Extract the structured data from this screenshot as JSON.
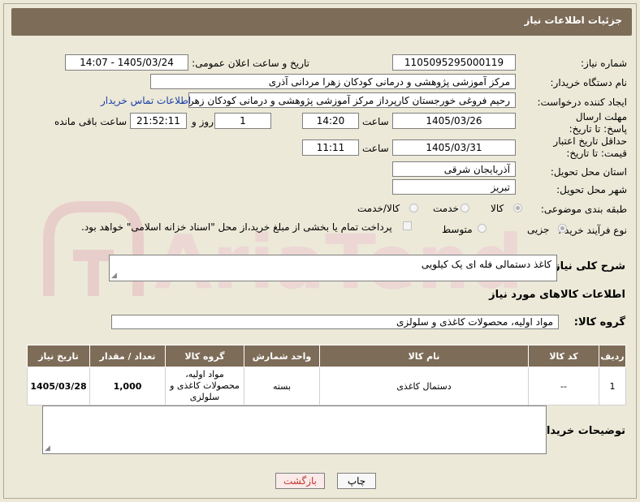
{
  "header": {
    "title": "جزئیات اطلاعات نیاز"
  },
  "need_number": {
    "label": "شماره نیاز:",
    "value": "1105095295000119"
  },
  "announce": {
    "label": "تاریخ و ساعت اعلان عمومی:",
    "value": "1405/03/24 - 14:07"
  },
  "buyer_org": {
    "label": "نام دستگاه خریدار:",
    "value": "مرکز آموزشی پژوهشی و درمانی کودکان زهرا مردانی آذری"
  },
  "creator": {
    "label": "ایجاد کننده درخواست:",
    "value": "رحیم فروغی خورجستان کارپرداز مرکز آموزشی پژوهشی و درمانی کودکان زهرا",
    "contact_link": "اطلاعات تماس خریدار"
  },
  "deadline": {
    "label": "مهلت ارسال پاسخ: تا تاریخ:",
    "date": "1405/03/26",
    "time_label": "ساعت",
    "time": "14:20",
    "days": "1",
    "days_label": "روز و",
    "remaining": "21:52:11",
    "remaining_label": "ساعت باقی مانده"
  },
  "price_validity": {
    "label": "حداقل تاریخ اعتبار قیمت: تا تاریخ:",
    "date": "1405/03/31",
    "time_label": "ساعت",
    "time": "11:11"
  },
  "province": {
    "label": "استان محل تحویل:",
    "value": "آذربایجان شرقی"
  },
  "city": {
    "label": "شهر محل تحویل:",
    "value": "تبریز"
  },
  "category": {
    "label": "طبقه بندی موضوعی:",
    "options": [
      "کالا",
      "خدمت",
      "کالا/خدمت"
    ],
    "selected": "کالا"
  },
  "process": {
    "label": "نوع فرآیند خرید :",
    "options": [
      "جزیی",
      "متوسط"
    ],
    "selected": "جزیی",
    "payment_note": "پرداخت تمام یا بخشی از مبلغ خرید،از محل \"اسناد خزانه اسلامی\" خواهد بود."
  },
  "description": {
    "label": "شرح کلی نیاز:",
    "value": "کاغذ دستمالی فله ای یک کیلویی"
  },
  "goods_info": {
    "title": "اطلاعات کالاهای مورد نیاز"
  },
  "goods_group": {
    "label": "گروه کالا:",
    "value": "مواد اولیه، محصولات کاغذی و سلولزی"
  },
  "table": {
    "headers": [
      "ردیف",
      "کد کالا",
      "نام کالا",
      "واحد شمارش",
      "گروه کالا",
      "تعداد / مقدار",
      "تاریخ نیاز"
    ],
    "rows": [
      {
        "index": "1",
        "code": "--",
        "name": "دستمال کاغذی",
        "unit": "بسته",
        "group": "مواد اولیه، محصولات کاغذی و سلولزی",
        "qty": "1,000",
        "date": "1405/03/28"
      }
    ]
  },
  "buyer_notes": {
    "label": "توضیحات خریدار:",
    "value": ""
  },
  "buttons": {
    "print": "چاپ",
    "back": "بازگشت"
  },
  "watermark": {
    "text": "AriaTender.neT"
  },
  "colors": {
    "header": "#7d6c58",
    "link": "#1a3ea8",
    "back_button_text": "#c0392b"
  }
}
